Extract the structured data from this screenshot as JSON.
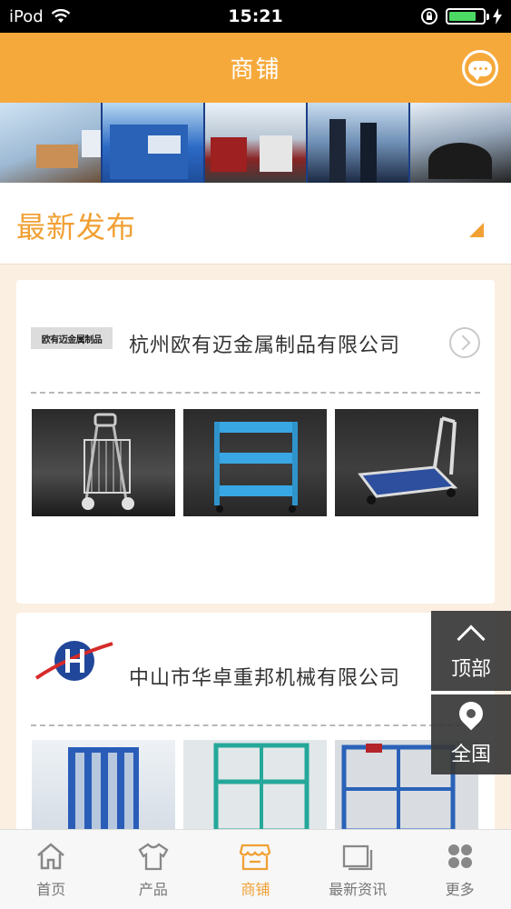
{
  "status_bar": {
    "carrier": "iPod",
    "time": "15:21",
    "battery_level": 0.8
  },
  "header": {
    "title": "商铺"
  },
  "section": {
    "title": "最新发布"
  },
  "shops": [
    {
      "logo_text": "欧有迈金属制品",
      "name": "杭州欧有迈金属制品有限公司"
    },
    {
      "name": "中山市华卓重邦机械有限公司"
    }
  ],
  "side_buttons": {
    "top_label": "顶部",
    "region_label": "全国"
  },
  "tabs": [
    {
      "label": "首页",
      "icon": "home-icon",
      "active": false
    },
    {
      "label": "产品",
      "icon": "shirt-icon",
      "active": false
    },
    {
      "label": "商铺",
      "icon": "store-icon",
      "active": true
    },
    {
      "label": "最新资讯",
      "icon": "news-icon",
      "active": false
    },
    {
      "label": "更多",
      "icon": "grid-icon",
      "active": false
    }
  ],
  "colors": {
    "accent": "#f6a93b",
    "accent_text": "#f1a034",
    "background": "#fbefe2"
  }
}
